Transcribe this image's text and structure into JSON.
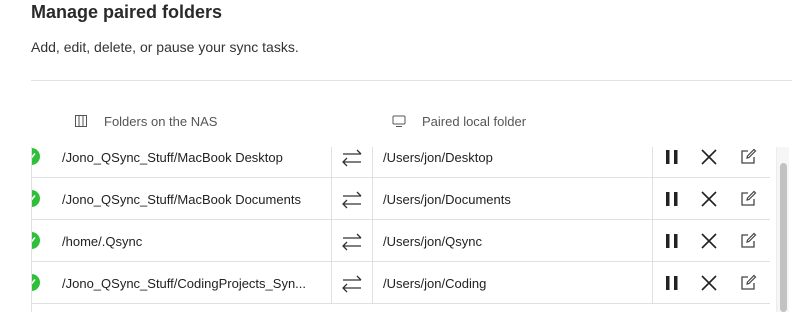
{
  "header": {
    "title": "Manage paired folders",
    "subtitle": "Add, edit, delete, or pause your sync tasks."
  },
  "columns": {
    "nas": {
      "label": "Folders on the NAS",
      "icon": "nas-icon"
    },
    "local": {
      "label": "Paired local folder",
      "icon": "monitor-icon"
    }
  },
  "rows": [
    {
      "nas_folder": "/Jono_QSync_Stuff/MacBook Desktop",
      "local_folder": "/Users/jon/Desktop",
      "status": "synced"
    },
    {
      "nas_folder": "/Jono_QSync_Stuff/MacBook Documents",
      "local_folder": "/Users/jon/Documents",
      "status": "synced"
    },
    {
      "nas_folder": "/home/.Qsync",
      "local_folder": "/Users/jon/Qsync",
      "status": "synced"
    },
    {
      "nas_folder": "/Jono_QSync_Stuff/CodingProjects_Syn...",
      "local_folder": "/Users/jon/Coding",
      "status": "synced"
    }
  ],
  "icons": {
    "status": "check-circle-icon",
    "sync": "two-way-sync-icon",
    "pause": "pause-icon",
    "delete": "close-icon",
    "edit": "edit-icon"
  },
  "colors": {
    "status_green": "#2fbf3b",
    "divider": "#e0e0e0"
  }
}
